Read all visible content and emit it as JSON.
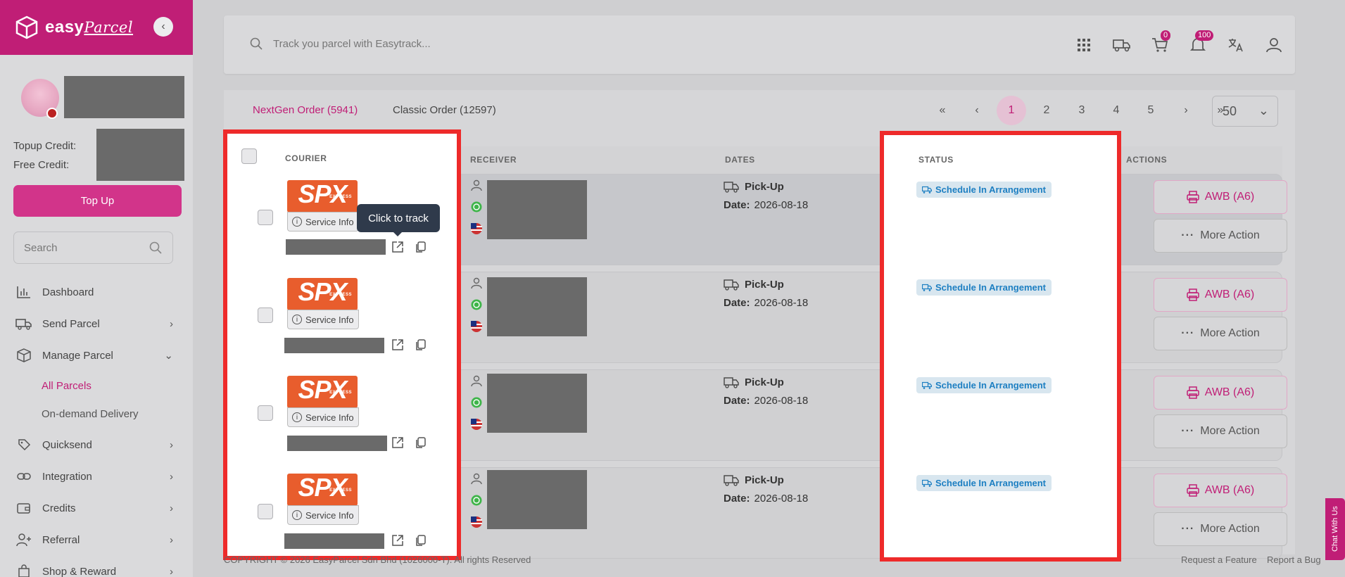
{
  "brand": {
    "name": "easy",
    "name_suffix": "Parcel"
  },
  "profile": {
    "topup_label": "Topup Credit:",
    "free_label": "Free Credit:"
  },
  "sidebar": {
    "topup_button": "Top Up",
    "search_placeholder": "Search",
    "items": [
      {
        "label": "Dashboard",
        "icon": "chart-icon"
      },
      {
        "label": "Send Parcel",
        "icon": "truck-icon"
      },
      {
        "label": "Manage Parcel",
        "icon": "box-icon"
      },
      {
        "label": "Quicksend",
        "icon": "tag-icon"
      },
      {
        "label": "Integration",
        "icon": "link-icon"
      },
      {
        "label": "Credits",
        "icon": "wallet-icon"
      },
      {
        "label": "Referral",
        "icon": "user-plus-icon"
      },
      {
        "label": "Shop & Reward",
        "icon": "shopping-bag-icon"
      }
    ],
    "sub_items": [
      {
        "label": "All Parcels",
        "active": true
      },
      {
        "label": "On-demand Delivery",
        "active": false
      }
    ]
  },
  "topbar": {
    "search_placeholder": "Track you parcel with Easytrack...",
    "cart_badge": "0",
    "notif_badge": "100"
  },
  "tabs": [
    {
      "label": "NextGen Order (5941)",
      "active": true
    },
    {
      "label": "Classic Order (12597)",
      "active": false
    }
  ],
  "pagination": {
    "first": "«",
    "prev": "‹",
    "next": "›",
    "last": "»",
    "pages": [
      "1",
      "2",
      "3",
      "4",
      "5"
    ],
    "current": "1",
    "per_page": "50"
  },
  "table": {
    "headers": {
      "courier": "COURIER",
      "receiver": "RECEIVER",
      "dates": "DATES",
      "status": "STATUS",
      "actions": "ACTIONS"
    },
    "rows": [
      {
        "courier": "SPX",
        "courier_sub": "EXPRESS",
        "service_info": "Service Info",
        "pickup_label": "Pick-Up",
        "date_label": "Date:",
        "date": "2026-08-18",
        "status": "Schedule In Arrangement",
        "awb": "AWB (A6)",
        "more": "More Action"
      },
      {
        "courier": "SPX",
        "courier_sub": "EXPRESS",
        "service_info": "Service Info",
        "pickup_label": "Pick-Up",
        "date_label": "Date:",
        "date": "2026-08-18",
        "status": "Schedule In Arrangement",
        "awb": "AWB (A6)",
        "more": "More Action"
      },
      {
        "courier": "SPX",
        "courier_sub": "EXPRESS",
        "service_info": "Service Info",
        "pickup_label": "Pick-Up",
        "date_label": "Date:",
        "date": "2026-08-18",
        "status": "Schedule In Arrangement",
        "awb": "AWB (A6)",
        "more": "More Action"
      },
      {
        "courier": "SPX",
        "courier_sub": "EXPRESS",
        "service_info": "Service Info",
        "pickup_label": "Pick-Up",
        "date_label": "Date:",
        "date": "2026-08-18",
        "status": "Schedule In Arrangement",
        "awb": "AWB (A6)",
        "more": "More Action"
      }
    ]
  },
  "tooltip": "Click to track",
  "footer": {
    "copyright": "COPYRIGHT © 2026 EasyParcel Sdn Bhd (1026000-T). All rights Reserved",
    "request_feature": "Request a Feature",
    "report_bug": "Report a Bug"
  },
  "chat": "Chat With Us",
  "colors": {
    "brand": "#c01e76",
    "status_blue": "#1d7fc2",
    "highlight_border": "#ee2a2a",
    "spx_orange": "#e85d2d"
  }
}
